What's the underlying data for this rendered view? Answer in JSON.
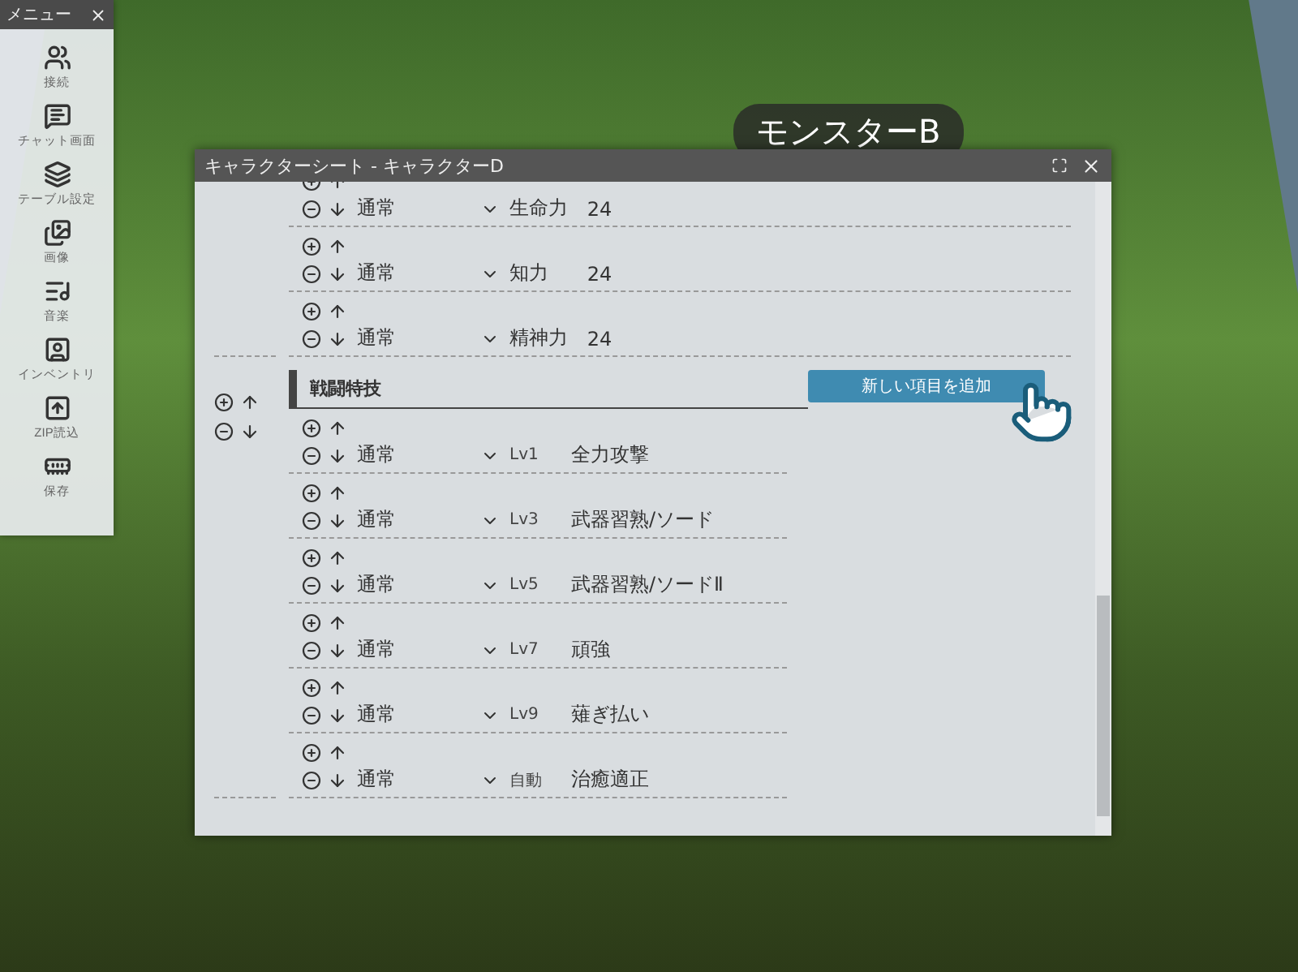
{
  "menu": {
    "title": "メニュー",
    "items": [
      {
        "label": "接続"
      },
      {
        "label": "チャット画面"
      },
      {
        "label": "テーブル設定"
      },
      {
        "label": "画像"
      },
      {
        "label": "音楽"
      },
      {
        "label": "インベントリ"
      },
      {
        "label": "ZIP読込"
      },
      {
        "label": "保存"
      }
    ]
  },
  "board": {
    "labels": [
      "モンスターB"
    ]
  },
  "window": {
    "title": "キャラクターシート - キャラクターD"
  },
  "sections": [
    {
      "kind": "stats",
      "items": [
        {
          "mode": "通常",
          "name": "生命力",
          "value": "24"
        },
        {
          "mode": "通常",
          "name": "知力",
          "value": "24"
        },
        {
          "mode": "通常",
          "name": "精神力",
          "value": "24"
        }
      ]
    },
    {
      "kind": "skills",
      "title": "戦闘特技",
      "add_button": "新しい項目を追加",
      "items": [
        {
          "mode": "通常",
          "level": "Lv1",
          "name": "全力攻撃"
        },
        {
          "mode": "通常",
          "level": "Lv3",
          "name": "武器習熟/ソード"
        },
        {
          "mode": "通常",
          "level": "Lv5",
          "name": "武器習熟/ソードⅡ"
        },
        {
          "mode": "通常",
          "level": "Lv7",
          "name": "頑強"
        },
        {
          "mode": "通常",
          "level": "Lv9",
          "name": "薙ぎ払い"
        },
        {
          "mode": "通常",
          "level": "自動",
          "name": "治癒適正"
        }
      ]
    }
  ]
}
